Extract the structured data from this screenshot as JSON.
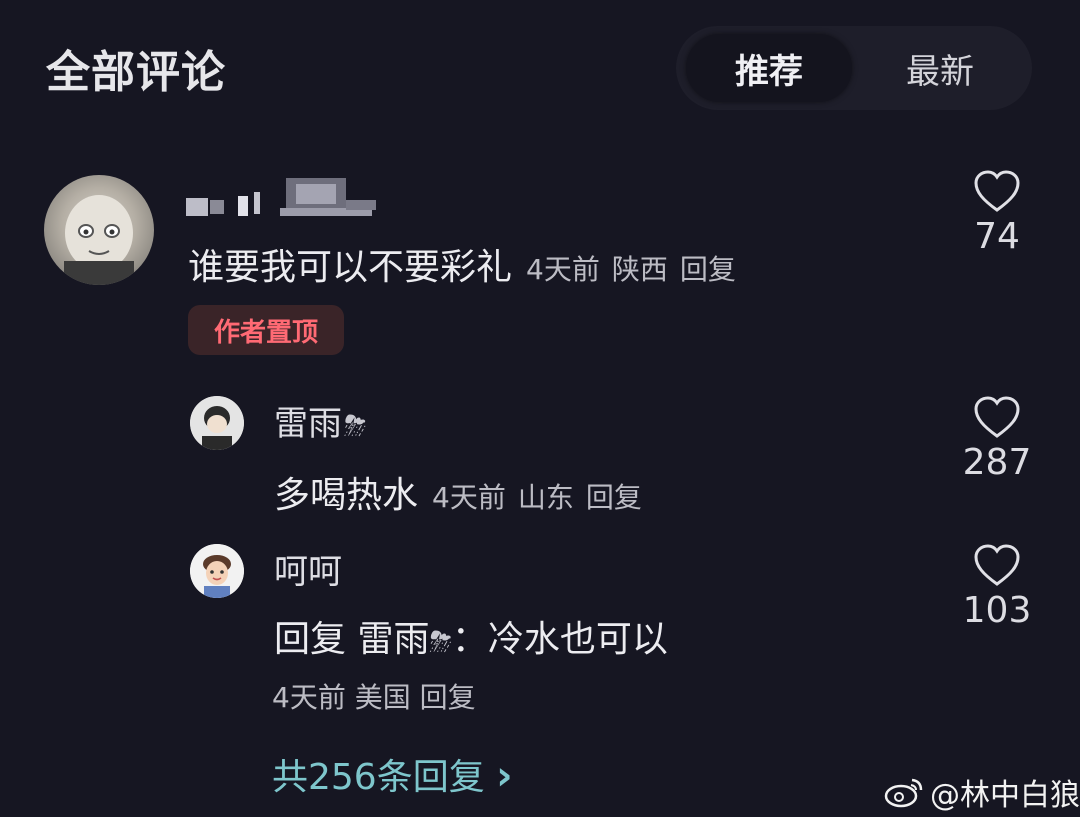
{
  "header": {
    "title": "全部评论",
    "tabs": [
      {
        "label": "推荐",
        "active": true
      },
      {
        "label": "最新",
        "active": false
      }
    ]
  },
  "comments": [
    {
      "text": "谁要我可以不要彩礼",
      "time": "4天前",
      "location": "陕西",
      "reply_label": "回复",
      "badge": "作者置顶",
      "likes": "74"
    }
  ],
  "replies": [
    {
      "username": "雷雨",
      "text": "多喝热水",
      "time": "4天前",
      "location": "山东",
      "reply_label": "回复",
      "likes": "287"
    },
    {
      "username": "呵呵",
      "reply_prefix": "回复",
      "reply_to": "雷雨",
      "text": "：冷水也可以",
      "time": "4天前",
      "location": "美国",
      "reply_label": "回复",
      "likes": "103"
    }
  ],
  "more_replies": {
    "label": "共256条回复",
    "chevron": "›"
  },
  "watermark": {
    "text": "@林中白狼",
    "icon": "weibo-icon"
  },
  "colors": {
    "background": "#161622",
    "badge_text": "#ff6a74",
    "badge_bg": "#3a2428",
    "link": "#7ec6cc"
  }
}
